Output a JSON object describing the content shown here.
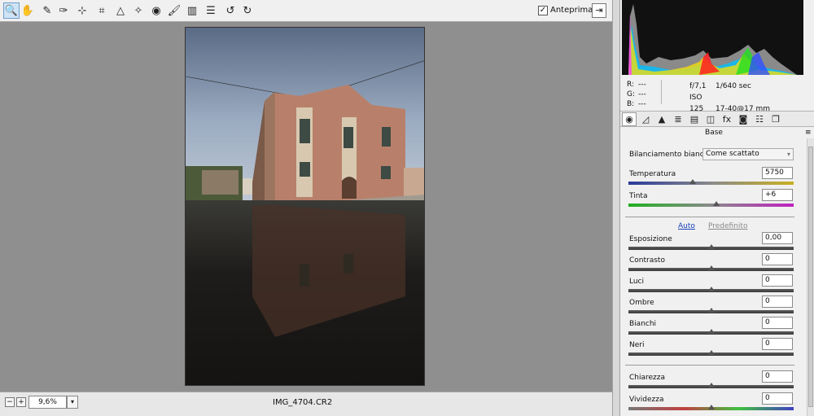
{
  "toolbar": {
    "tools": [
      {
        "name": "zoom-tool",
        "icon": "magnifier-icon",
        "glyph": "🔍",
        "active": true
      },
      {
        "name": "hand-tool",
        "icon": "hand-icon",
        "glyph": "✋",
        "active": false
      },
      {
        "name": "white-balance-tool",
        "icon": "eyedropper-icon",
        "glyph": "✎",
        "active": false
      },
      {
        "name": "color-sampler-tool",
        "icon": "color-sampler-icon",
        "glyph": "✑",
        "active": false
      },
      {
        "name": "targeted-adjustment-tool",
        "icon": "target-icon",
        "glyph": "⊹",
        "active": false
      },
      {
        "name": "crop-tool",
        "icon": "crop-icon",
        "glyph": "⌗",
        "active": false
      },
      {
        "name": "straighten-tool",
        "icon": "straighten-icon",
        "glyph": "△",
        "active": false
      },
      {
        "name": "spot-removal-tool",
        "icon": "spot-removal-icon",
        "glyph": "✧",
        "active": false
      },
      {
        "name": "red-eye-tool",
        "icon": "red-eye-icon",
        "glyph": "◉",
        "active": false
      },
      {
        "name": "adjustment-brush-tool",
        "icon": "brush-icon",
        "glyph": "🖌",
        "active": false
      },
      {
        "name": "graduated-filter-tool",
        "icon": "graduated-filter-icon",
        "glyph": "▥",
        "active": false
      },
      {
        "name": "preferences-tool",
        "icon": "list-icon",
        "glyph": "☰",
        "active": false
      },
      {
        "name": "rotate-left-tool",
        "icon": "rotate-left-icon",
        "glyph": "↺",
        "active": false
      },
      {
        "name": "rotate-right-tool",
        "icon": "rotate-right-icon",
        "glyph": "↻",
        "active": false
      }
    ],
    "preview_checked": true,
    "preview_label": "Anteprima"
  },
  "status": {
    "zoom_out": "−",
    "zoom_in": "+",
    "zoom_value": "9,6%",
    "filename": "IMG_4704.CR2"
  },
  "info": {
    "r_label": "R:",
    "r_value": "---",
    "g_label": "G:",
    "g_value": "---",
    "b_label": "B:",
    "b_value": "---",
    "aperture": "f/7,1",
    "shutter": "1/640 sec",
    "iso": "ISO 125",
    "lens": "17-40@17 mm"
  },
  "panel": {
    "title": "Base",
    "tabs": [
      {
        "name": "tab-basic",
        "icon": "basic-icon",
        "glyph": "◉",
        "active": true
      },
      {
        "name": "tab-tone-curve",
        "icon": "tone-curve-icon",
        "glyph": "◿",
        "active": false
      },
      {
        "name": "tab-detail",
        "icon": "detail-icon",
        "glyph": "▲",
        "active": false
      },
      {
        "name": "tab-hsl",
        "icon": "hsl-icon",
        "glyph": "≣",
        "active": false
      },
      {
        "name": "tab-split-toning",
        "icon": "split-toning-icon",
        "glyph": "▤",
        "active": false
      },
      {
        "name": "tab-lens-corrections",
        "icon": "lens-icon",
        "glyph": "◫",
        "active": false
      },
      {
        "name": "tab-effects",
        "icon": "fx-icon",
        "glyph": "fx",
        "active": false
      },
      {
        "name": "tab-camera-calibration",
        "icon": "camera-icon",
        "glyph": "◙",
        "active": false
      },
      {
        "name": "tab-presets",
        "icon": "presets-icon",
        "glyph": "☷",
        "active": false
      },
      {
        "name": "tab-snapshots",
        "icon": "snapshots-icon",
        "glyph": "❐",
        "active": false
      }
    ],
    "white_balance_label": "Bilanciamento bianco:",
    "white_balance_value": "Come scattato",
    "temperature_label": "Temperatura",
    "temperature_value": "5750",
    "temperature_pos": 0.39,
    "tint_label": "Tinta",
    "tint_value": "+6",
    "tint_pos": 0.53,
    "auto_label": "Auto",
    "default_label": "Predefinito",
    "sliders": [
      {
        "key": "exposure",
        "label": "Esposizione",
        "value": "0,00",
        "pos": 0.5
      },
      {
        "key": "contrast",
        "label": "Contrasto",
        "value": "0",
        "pos": 0.5
      },
      {
        "key": "highlights",
        "label": "Luci",
        "value": "0",
        "pos": 0.5
      },
      {
        "key": "shadows",
        "label": "Ombre",
        "value": "0",
        "pos": 0.5
      },
      {
        "key": "whites",
        "label": "Bianchi",
        "value": "0",
        "pos": 0.5
      },
      {
        "key": "blacks",
        "label": "Neri",
        "value": "0",
        "pos": 0.5
      }
    ],
    "presence_sliders": [
      {
        "key": "clarity",
        "label": "Chiarezza",
        "value": "0",
        "pos": 0.5
      },
      {
        "key": "vibrance",
        "label": "Vividezza",
        "value": "0",
        "pos": 0.5
      }
    ]
  },
  "colors": {
    "accent": "#1a44b8",
    "active_tool_bg": "#cfe3f7"
  }
}
